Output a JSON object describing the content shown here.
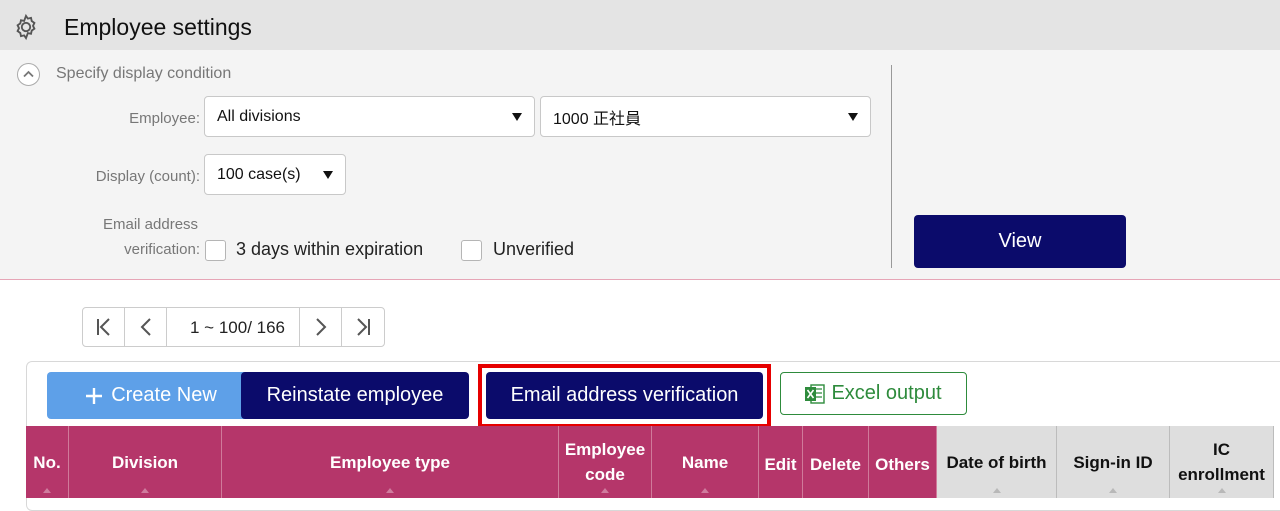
{
  "header": {
    "title": "Employee settings",
    "icon": "gear-icon"
  },
  "condition": {
    "title": "Specify display condition",
    "employee_label": "Employee:",
    "division_select": "All divisions",
    "type_select": "1000 正社員",
    "display_label": "Display (count):",
    "count_select": "100 case(s)",
    "email_label_line1": "Email address",
    "email_label_line2": "verification:",
    "check1_label": "3 days within expiration",
    "check2_label": "Unverified",
    "view_button": "View"
  },
  "pager": {
    "info": "1 ~ 100/ 166"
  },
  "actions": {
    "create_new": "Create New",
    "reinstate": "Reinstate employee",
    "email_verification": "Email address verification",
    "excel_output": "Excel output"
  },
  "table": {
    "columns": [
      "No.",
      "Division",
      "Employee type",
      "Employee code",
      "Name",
      "Edit",
      "Delete",
      "Others",
      "Date of birth",
      "Sign-in ID",
      "IC enrollment"
    ]
  },
  "colors": {
    "primary": "#0b0b6b",
    "create": "#5ea0e8",
    "header_pink": "#b5366a",
    "excel_green": "#2e8b3c",
    "highlight": "#e60000"
  }
}
